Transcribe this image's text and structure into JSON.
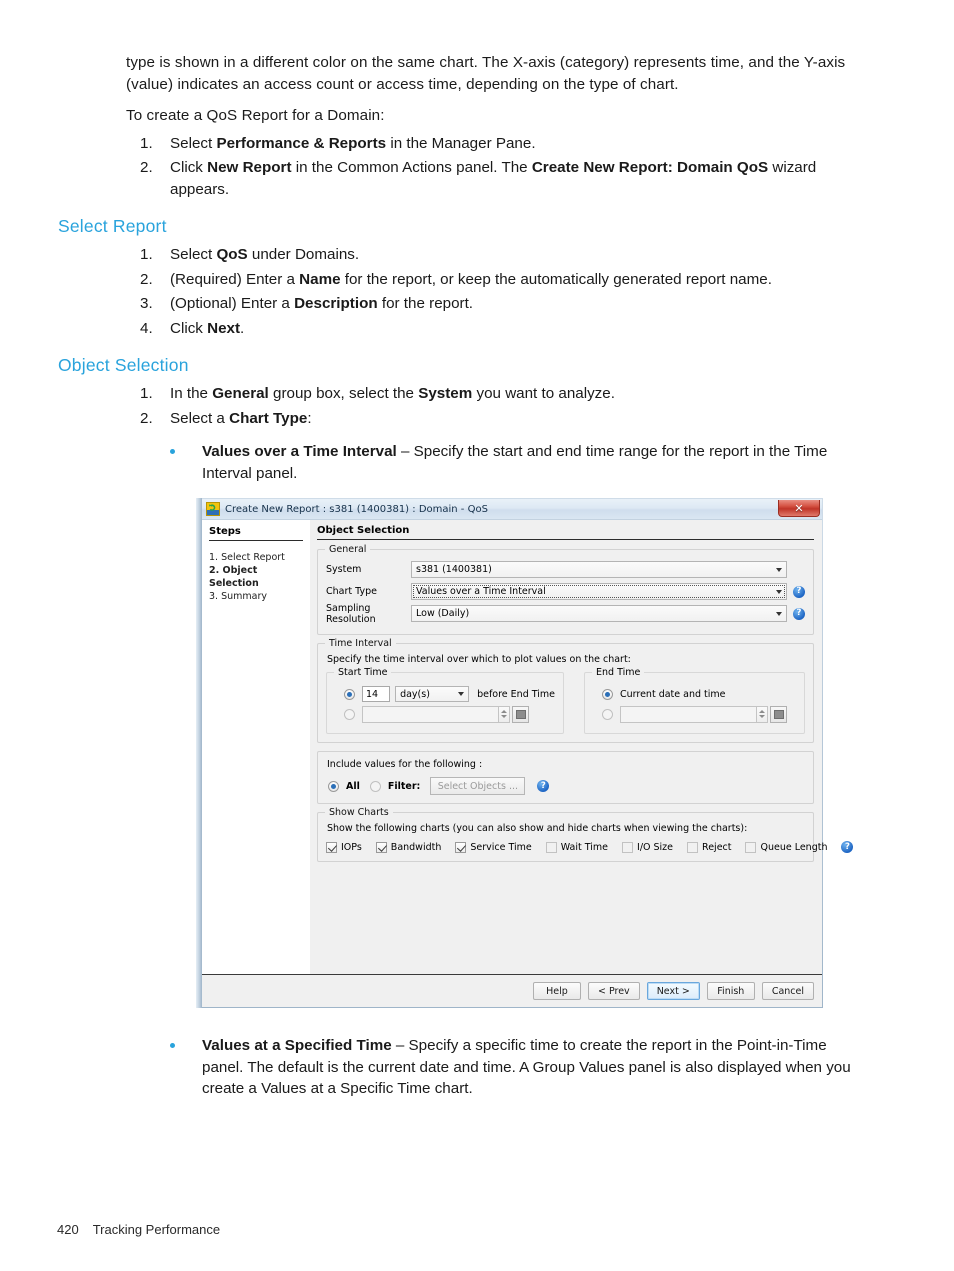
{
  "document": {
    "intro_paragraph": "type is shown in a different color on the same chart. The X-axis (category) represents time, and the Y-axis (value) indicates an access count or access time, depending on the type of chart.",
    "lead_in": "To create a QoS Report for a Domain:",
    "intro_steps": [
      {
        "num": "1.",
        "pre": "Select ",
        "bold": "Performance & Reports",
        "post": " in the Manager Pane."
      },
      {
        "num": "2.",
        "pre": "Click ",
        "bold": "New Report",
        "mid": " in the Common Actions panel. The ",
        "bold2": "Create New Report: Domain QoS",
        "post": " wizard appears."
      }
    ],
    "sections": [
      {
        "heading": "Select Report",
        "steps": [
          {
            "num": "1.",
            "pre": "Select ",
            "bold": "QoS",
            "post": " under Domains."
          },
          {
            "num": "2.",
            "pre": "(Required) Enter a ",
            "bold": "Name",
            "post": " for the report, or keep the automatically generated report name."
          },
          {
            "num": "3.",
            "pre": "(Optional) Enter a ",
            "bold": "Description",
            "post": " for the report."
          },
          {
            "num": "4.",
            "pre": "Click ",
            "bold": "Next",
            "post": "."
          }
        ]
      },
      {
        "heading": "Object Selection",
        "steps": [
          {
            "num": "1.",
            "pre": "In the ",
            "bold": "General",
            "mid": " group box, select the ",
            "bold2": "System",
            "post": " you want to analyze."
          },
          {
            "num": "2.",
            "pre": "Select a ",
            "bold": "Chart Type",
            "post": ":"
          }
        ]
      }
    ],
    "bullets": [
      {
        "bold": "Values over a Time Interval",
        "text": " – Specify the start and end time range for the report in the Time Interval panel."
      },
      {
        "bold": "Values at a Specified Time",
        "text": " – Specify a specific time to create the report in the Point-in-Time panel. The default is the current date and time. A Group Values panel is also displayed when you create a Values at a Specific Time chart."
      }
    ],
    "footer": {
      "page_number": "420",
      "chapter": "Tracking Performance"
    },
    "heading_color": "#29a3dc"
  },
  "dialog": {
    "titlebar": {
      "title": "Create New Report : s381 (1400381) : Domain - QoS",
      "close_label": "✕",
      "icon_name": "app-icon"
    },
    "steps_pane": {
      "title": "Steps",
      "items": [
        {
          "label": "1. Select Report",
          "active": false
        },
        {
          "label": "2. Object Selection",
          "active": true
        },
        {
          "label": "3. Summary",
          "active": false
        }
      ]
    },
    "content": {
      "title": "Object Selection",
      "general": {
        "legend": "General",
        "fields": [
          {
            "label": "System",
            "value": "s381 (1400381)",
            "help": false,
            "focused": false
          },
          {
            "label": "Chart Type",
            "value": "Values over a Time Interval",
            "help": true,
            "focused": true
          },
          {
            "label": "Sampling Resolution",
            "value": "Low (Daily)",
            "help": true,
            "focused": false
          }
        ]
      },
      "time_interval": {
        "legend": "Time Interval",
        "hint": "Specify the time interval over which to plot values on the chart:",
        "start_time": {
          "legend": "Start Time",
          "relative_selected": true,
          "amount": "14",
          "unit": "day(s)",
          "suffix": "before End Time",
          "absolute_selected": false,
          "absolute_value": ""
        },
        "end_time": {
          "legend": "End Time",
          "current_label": "Current date and time",
          "current_selected": true,
          "absolute_selected": false,
          "absolute_value": ""
        }
      },
      "include_values": {
        "hint": "Include values for the following :",
        "all_label": "All",
        "all_selected": true,
        "filter_label": "Filter:",
        "filter_selected": false,
        "select_objects_label": "Select Objects ...",
        "help": true
      },
      "show_charts": {
        "legend": "Show Charts",
        "hint": "Show the following charts (you can also show and hide charts when viewing the charts):",
        "items": [
          {
            "label": "IOPs",
            "checked": true
          },
          {
            "label": "Bandwidth",
            "checked": true
          },
          {
            "label": "Service Time",
            "checked": true
          },
          {
            "label": "Wait Time",
            "checked": false
          },
          {
            "label": "I/O Size",
            "checked": false
          },
          {
            "label": "Reject",
            "checked": false
          },
          {
            "label": "Queue Length",
            "checked": false
          }
        ],
        "help": true
      }
    },
    "buttons": [
      {
        "label": "Help",
        "default": false
      },
      {
        "label": "< Prev",
        "default": false
      },
      {
        "label": "Next >",
        "default": true
      },
      {
        "label": "Finish",
        "default": false
      },
      {
        "label": "Cancel",
        "default": false
      }
    ]
  }
}
